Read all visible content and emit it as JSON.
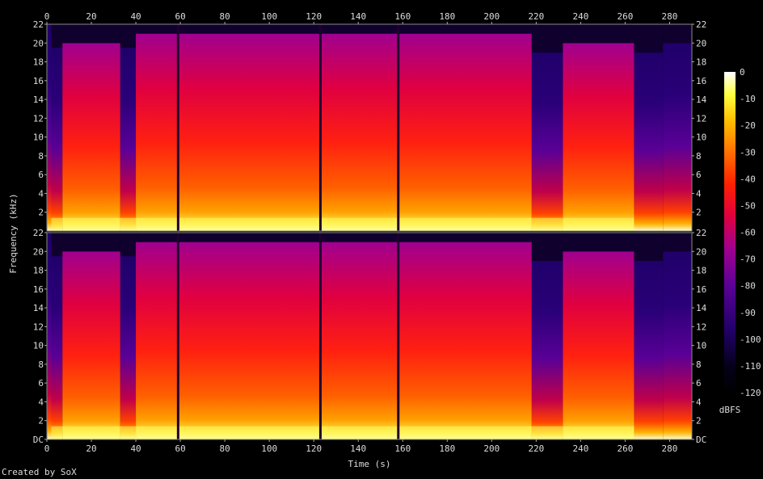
{
  "chart_data": {
    "type": "heatmap",
    "title": "",
    "xlabel": "Time (s)",
    "ylabel": "Frequency (kHz)",
    "xlim": [
      0,
      290
    ],
    "x_ticks": [
      "0",
      "20",
      "40",
      "60",
      "80",
      "100",
      "120",
      "140",
      "160",
      "180",
      "200",
      "220",
      "240",
      "260",
      "280"
    ],
    "channels": [
      {
        "y_ticks": [
          "2",
          "4",
          "6",
          "8",
          "10",
          "12",
          "14",
          "16",
          "18",
          "20",
          "22"
        ]
      },
      {
        "y_ticks": [
          "DC",
          "2",
          "4",
          "6",
          "8",
          "10",
          "12",
          "14",
          "16",
          "18",
          "20",
          "22"
        ]
      }
    ],
    "ylim_khz": [
      0,
      22
    ],
    "colorbar": {
      "label": "dBFS",
      "range": [
        -120,
        0
      ],
      "ticks": [
        "-120",
        "-110",
        "-100",
        "-90",
        "-80",
        "-70",
        "-60",
        "-50",
        "-40",
        "-30",
        "-20",
        "-10",
        "0"
      ]
    },
    "segments": [
      {
        "t0": 0,
        "t1": 2,
        "cut_khz": 22,
        "level": 0.2
      },
      {
        "t0": 2,
        "t1": 7,
        "cut_khz": 19.5,
        "level": 0.5
      },
      {
        "t0": 7,
        "t1": 33,
        "cut_khz": 20,
        "level": 0.62
      },
      {
        "t0": 33,
        "t1": 40,
        "cut_khz": 19.5,
        "level": 0.5
      },
      {
        "t0": 40,
        "t1": 218,
        "cut_khz": 21,
        "level": 0.72
      },
      {
        "t0": 218,
        "t1": 232,
        "cut_khz": 19,
        "level": 0.42
      },
      {
        "t0": 232,
        "t1": 264,
        "cut_khz": 20,
        "level": 0.64
      },
      {
        "t0": 264,
        "t1": 277,
        "cut_khz": 19,
        "level": 0.36
      },
      {
        "t0": 277,
        "t1": 290,
        "cut_khz": 20,
        "level": 0.4
      }
    ],
    "gaps_s": [
      59,
      123,
      158
    ]
  },
  "credit": "Created by SoX"
}
